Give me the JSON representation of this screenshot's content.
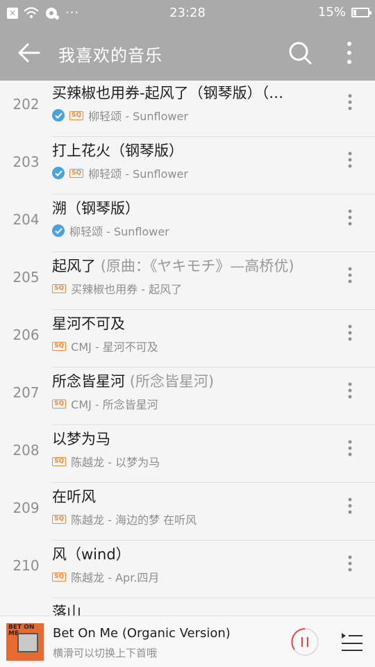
{
  "status_bar": {
    "time": "23:28",
    "battery": "15%"
  },
  "header": {
    "title": "我喜欢的音乐"
  },
  "songs": [
    {
      "num": "202",
      "title": "买辣椒也用券-起风了（钢琴版）（…",
      "subtitle": "",
      "artist": "柳轻颂 - Sunflower",
      "checked": true,
      "sq": true
    },
    {
      "num": "203",
      "title": "打上花火（钢琴版）",
      "subtitle": "",
      "artist": "柳轻颂 - Sunflower",
      "checked": true,
      "sq": true
    },
    {
      "num": "204",
      "title": "溯（钢琴版）",
      "subtitle": "",
      "artist": "柳轻颂 - Sunflower",
      "checked": true,
      "sq": false
    },
    {
      "num": "205",
      "title": "起风了 ",
      "subtitle": "(原曲：《ヤキモチ》—高桥优)",
      "artist": "买辣椒也用券 - 起风了",
      "checked": false,
      "sq": true
    },
    {
      "num": "206",
      "title": "星河不可及",
      "subtitle": "",
      "artist": "CMJ - 星河不可及",
      "checked": false,
      "sq": true
    },
    {
      "num": "207",
      "title": "所念皆星河 ",
      "subtitle": "(所念皆星河)",
      "artist": "CMJ - 所念皆星河",
      "checked": false,
      "sq": true
    },
    {
      "num": "208",
      "title": "以梦为马",
      "subtitle": "",
      "artist": "陈越龙 - 以梦为马",
      "checked": false,
      "sq": true
    },
    {
      "num": "209",
      "title": "在听风",
      "subtitle": "",
      "artist": "陈越龙 - 海边的梦 在听风",
      "checked": false,
      "sq": true
    },
    {
      "num": "210",
      "title": "风（wind）",
      "subtitle": "",
      "artist": "陈越龙 - Apr.四月",
      "checked": false,
      "sq": true
    },
    {
      "num": "",
      "title": "落山",
      "subtitle": "",
      "artist": "",
      "checked": false,
      "sq": false
    }
  ],
  "sq_label": "SQ",
  "player": {
    "title": "Bet On Me (Organic Version)",
    "hint": "横滑可以切换上下首哦",
    "cover_text": "BET ON ME"
  },
  "colors": {
    "accent": "#f08a3a",
    "check": "#4aa3df",
    "bar": "#a9aaa9",
    "play": "#e24b4b"
  }
}
